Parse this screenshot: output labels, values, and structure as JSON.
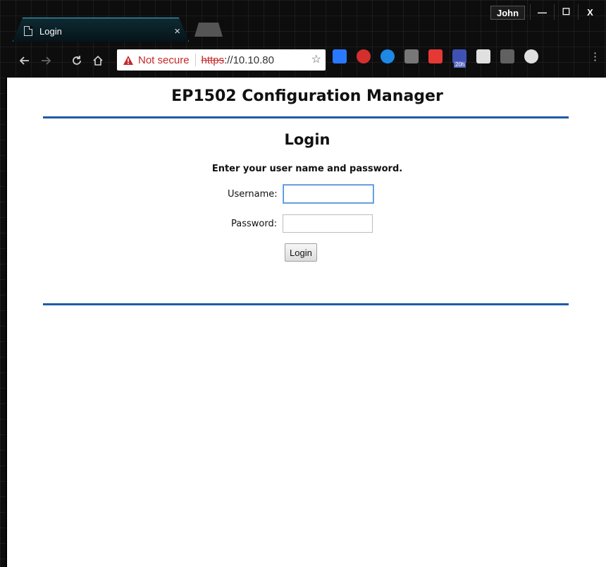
{
  "browser": {
    "tab": {
      "title": "Login",
      "close": "×"
    },
    "user": "John",
    "window_controls": {
      "minimize": "—",
      "maximize": "☐",
      "close": "X"
    },
    "omnibox": {
      "security_label": "Not secure",
      "url_scheme": "https",
      "url_rest": "://10.10.80",
      "bookmark_icon": "star-icon"
    },
    "extensions": [
      {
        "name": "bitly-icon",
        "color": "#2979ff"
      },
      {
        "name": "adblock-icon",
        "color": "#d32f2f"
      },
      {
        "name": "e-icon",
        "color": "#1e88e5"
      },
      {
        "name": "d-icon",
        "color": "#777777"
      },
      {
        "name": "bookmark-red-icon",
        "color": "#e53935"
      },
      {
        "name": "chat-icon",
        "color": "#3f51b5",
        "badge": "20h"
      },
      {
        "name": "card-icon",
        "color": "#e0e0e0"
      },
      {
        "name": "pdf-icon",
        "color": "#616161"
      },
      {
        "name": "eye-off-icon",
        "color": "#e0e0e0"
      }
    ]
  },
  "page": {
    "header": "EP1502 Configuration Manager",
    "login_title": "Login",
    "instructions": "Enter your user name and password.",
    "username_label": "Username:",
    "username_value": "",
    "password_label": "Password:",
    "password_value": "",
    "login_button": "Login"
  },
  "colors": {
    "rule": "#1f5aa6",
    "tab_border": "#3fb7d4",
    "insecure": "#c62828"
  }
}
